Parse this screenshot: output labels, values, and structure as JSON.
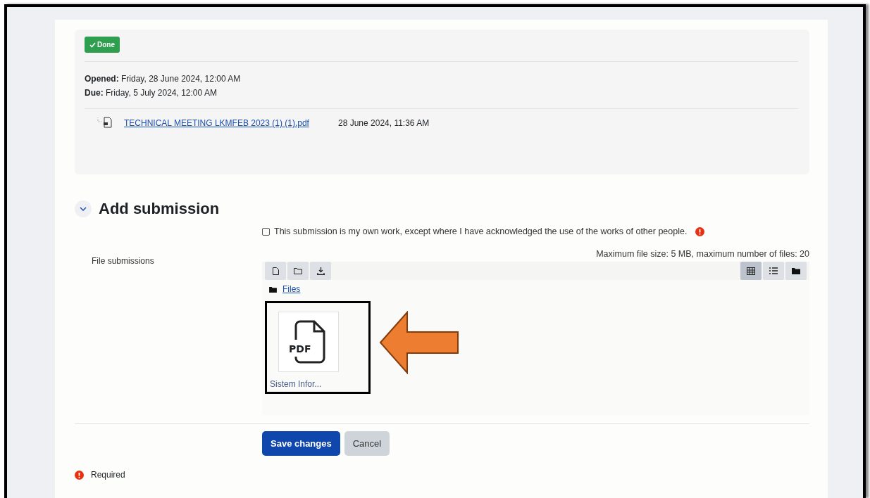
{
  "status_badge": {
    "label": "Done",
    "done": true
  },
  "dates": [
    {
      "label": "Opened:",
      "value": "Friday, 28 June 2024, 12:00 AM"
    },
    {
      "label": "Due:",
      "value": "Friday, 5 July 2024, 12:00 AM"
    }
  ],
  "attachment": {
    "name": "TECHNICAL MEETING LKMFEB 2023 (1) (1).pdf",
    "date": "28 June 2024, 11:36 AM"
  },
  "section": {
    "title": "Add submission",
    "expanded": true
  },
  "statement": {
    "text": "This submission is my own work, except where I have acknowledged the use of the works of other people.",
    "checked": false,
    "required": true
  },
  "file_submissions": {
    "label": "File submissions",
    "limits": "Maximum file size: 5 MB, maximum number of files: 20",
    "views": [
      {
        "kind": "grid",
        "selected": true
      },
      {
        "kind": "list",
        "selected": false
      },
      {
        "kind": "tree",
        "selected": false
      }
    ],
    "path": "Files",
    "files": [
      {
        "type": "PDF",
        "name": "Sistem Infor...",
        "highlighted": true
      }
    ]
  },
  "buttons": [
    {
      "label": "Save changes",
      "kind": "primary"
    },
    {
      "label": "Cancel",
      "kind": "secondary"
    }
  ],
  "required_note": "Required"
}
